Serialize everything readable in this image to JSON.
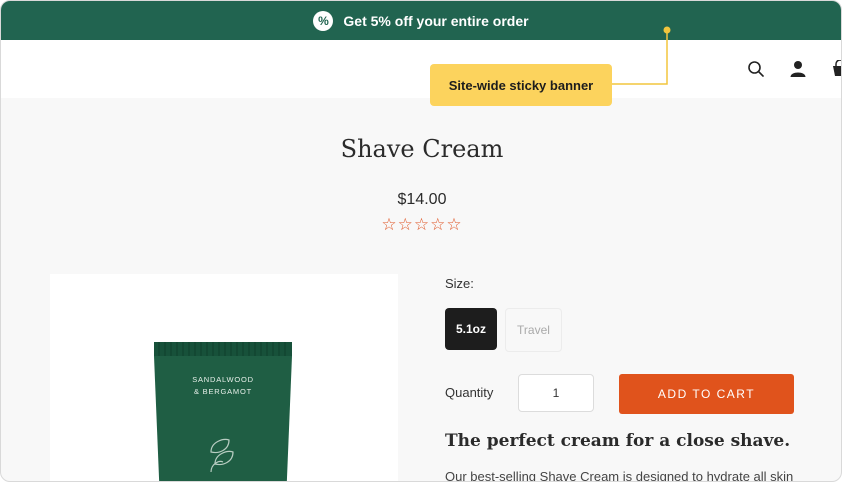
{
  "banner": {
    "badge_icon": "%",
    "text": "Get 5% off your entire order"
  },
  "callout": {
    "text": "Site-wide sticky banner"
  },
  "header": {
    "icons": [
      "search-icon",
      "account-icon",
      "cart-icon"
    ]
  },
  "product": {
    "title": "Shave Cream",
    "price": "$14.00",
    "rating_stars": "☆☆☆☆☆",
    "tube_label_line1": "SANDALWOOD",
    "tube_label_line2": "& BERGAMOT"
  },
  "size": {
    "label": "Size:",
    "options": [
      "5.1oz",
      "Travel"
    ],
    "selected": "5.1oz"
  },
  "quantity": {
    "label": "Quantity",
    "value": "1"
  },
  "cart": {
    "button_label": "ADD TO CART"
  },
  "description": {
    "heading": "The perfect cream for a close shave.",
    "text": "Our best-selling Shave Cream is designed to hydrate all skin"
  },
  "colors": {
    "banner": "#216450",
    "accent": "#e0531c",
    "callout": "#fcd35d",
    "tube": "#1f5e44"
  }
}
